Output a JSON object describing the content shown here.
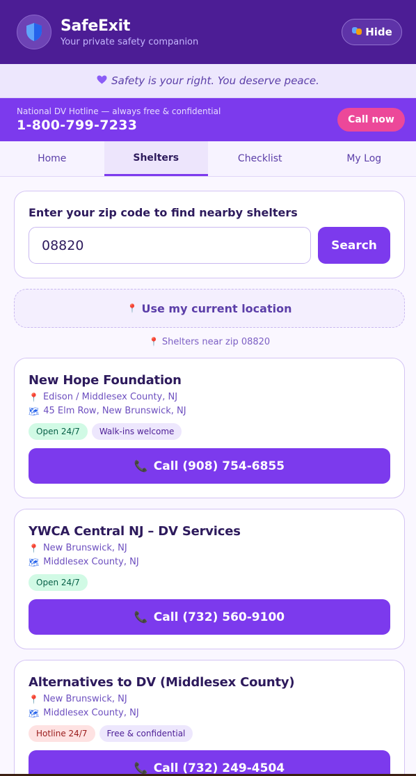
{
  "header": {
    "app_name": "SafeExit",
    "tagline": "Your private safety companion",
    "hide_label": "Hide",
    "hide_icon": "mask-icon",
    "logo_icon": "shield-icon"
  },
  "affirmation": {
    "text": "Safety is your right. You deserve peace.",
    "icon": "purple-heart-icon"
  },
  "hotline": {
    "label": "National DV Hotline — always free & confidential",
    "number": "1-800-799-7233",
    "call_label": "Call now"
  },
  "tabs": [
    {
      "label": "Home"
    },
    {
      "label": "Shelters",
      "active": true
    },
    {
      "label": "Checklist"
    },
    {
      "label": "My Log"
    }
  ],
  "search": {
    "label": "Enter your zip code to find nearby shelters",
    "value": "08820",
    "button": "Search"
  },
  "location": {
    "button": "Use my current location",
    "near_label": "Shelters near zip 08820"
  },
  "shelters": [
    {
      "name": "New Hope Foundation",
      "location": "Edison / Middlesex County, NJ",
      "address": "45 Elm Row, New Brunswick, NJ",
      "badges": [
        "Open 24/7",
        "Walk-ins welcome"
      ],
      "call": "Call (908) 754-6855"
    },
    {
      "name": "YWCA Central NJ – DV Services",
      "location": "New Brunswick, NJ",
      "address": "Middlesex County, NJ",
      "badges": [
        "Open 24/7"
      ],
      "call": "Call (732) 560-9100"
    },
    {
      "name": "Alternatives to DV (Middlesex County)",
      "location": "New Brunswick, NJ",
      "address": "Middlesex County, NJ",
      "badges": [
        "Hotline 24/7",
        "Free & confidential"
      ],
      "call": "Call (732) 249-4504"
    }
  ],
  "colors": {
    "header": "#4c1d95",
    "accent": "#7c3aed",
    "call_now": "#ec4899"
  }
}
